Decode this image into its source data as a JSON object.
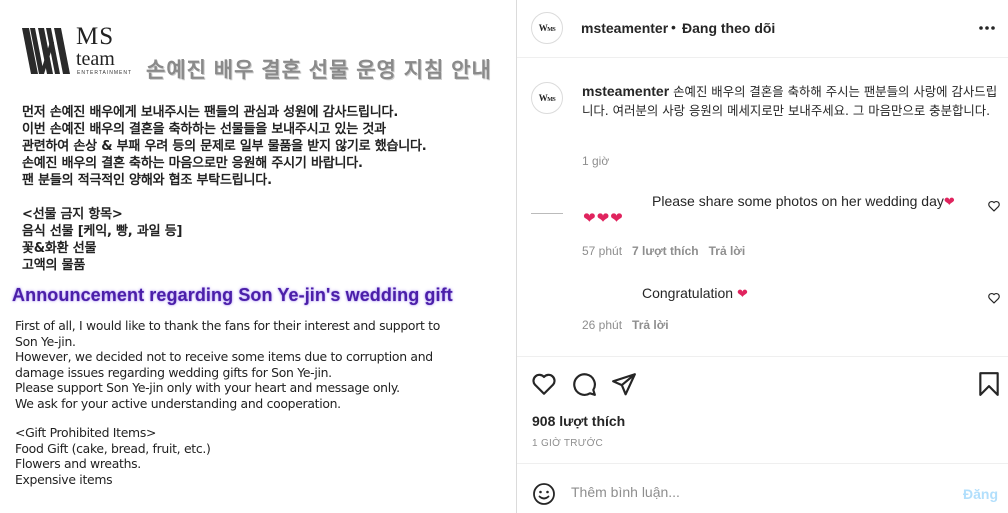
{
  "image": {
    "logo": {
      "ms": "MS",
      "team": "team",
      "ent": "ENTERTAINMENT"
    },
    "ko_title": "손예진 배우 결혼 선물 운영 지침 안내",
    "ko_lines": [
      "먼저 손예진 배우에게 보내주시는 팬들의 관심과 성원에 감사드립니다.",
      "이번 손예진 배우의 결혼을 축하하는 선물들을 보내주시고 있는 것과",
      "관련하여 손상 & 부패 우려 등의 문제로 일부 물품을 받지 않기로 했습니다.",
      "손예진 배우의 결혼 축하는 마음으로만 응원해 주시기 바랍니다.",
      "팬 분들의 적극적인 양해와 협조 부탁드립니다."
    ],
    "ko_list": [
      "<선물 금지 항목>",
      "음식 선물 [케익, 빵, 과일 등]",
      "꽃&화환 선물",
      "고액의 물품"
    ],
    "en_title": "Announcement regarding Son Ye-jin's wedding gift",
    "en_lines": [
      "First of all, I would like to thank the fans for their interest and support to",
      "Son Ye-jin.",
      "However, we decided not to receive some items due to corruption and",
      "damage issues regarding wedding gifts for Son Ye-jin.",
      "Please support Son Ye-jin only with your heart and message only.",
      "We ask for your active understanding and cooperation."
    ],
    "en_list": [
      "<Gift Prohibited Items>",
      "Food Gift (cake, bread, fruit, etc.)",
      "Flowers and wreaths.",
      "Expensive items"
    ]
  },
  "header": {
    "username": "msteamenter",
    "dot": "•",
    "follow_state": "Đang theo dõi"
  },
  "caption": {
    "username": "msteamenter",
    "text": "손예진 배우의 결혼을 축하해 주시는 팬분들의 사랑에 감사드립니다. 여러분의 사랑 응원의 메세지로만 보내주세요. 그 마음만으로 충분합니다.",
    "time": "1 giờ"
  },
  "comments": [
    {
      "text": "Please share some photos on her wedding day",
      "time": "57 phút",
      "likes": "7 lượt thích",
      "reply": "Trả lời"
    },
    {
      "text": "Congratulation",
      "time": "26 phút",
      "reply": "Trả lời"
    }
  ],
  "footer": {
    "likes": "908 lượt thích",
    "time": "1 GIỜ TRƯỚC",
    "comment_placeholder": "Thêm bình luận...",
    "post_label": "Đăng"
  },
  "colors": {
    "heart": "#e0245e",
    "post_disabled": "#b2dffc",
    "en_title": "#4b1fa8"
  },
  "icons": [
    "more-options-icon",
    "heart-icon",
    "comment-icon",
    "share-icon",
    "bookmark-icon",
    "emoji-icon"
  ]
}
